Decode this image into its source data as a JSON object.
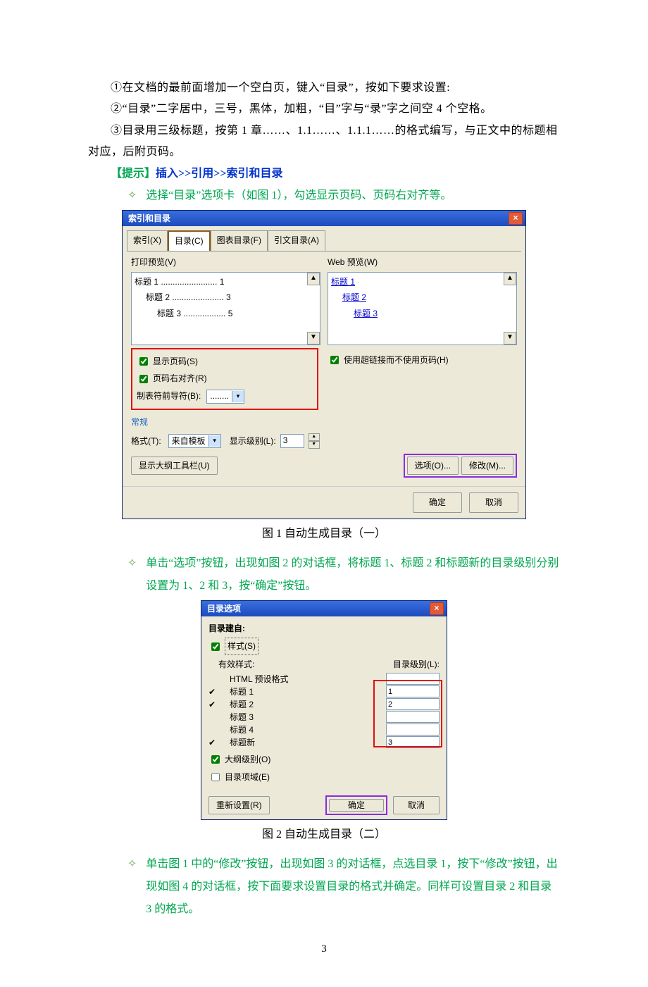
{
  "paragraphs": {
    "p1": "①在文档的最前面增加一个空白页，键入“目录”，按如下要求设置:",
    "p2": "②“目录”二字居中，三号，黑体，加粗，“目”字与“录”字之间空 4 个空格。",
    "p3": "③目录用三级标题，按第 1 章……、1.1……、1.1.1……的格式编写，与正文中的标题相对应，后附页码。",
    "tip_label": "【提示】",
    "tip_path": "插入>>引用>>索引和目录",
    "b1": "选择“目录”选项卡（如图 1），勾选显示页码、页码右对齐等。",
    "b2": "单击“选项”按钮，出现如图 2 的对话框，将标题 1、标题 2 和标题新的目录级别分别设置为 1、2 和 3，按“确定”按钮。",
    "b3": "单击图 1 中的“修改”按钮，出现如图 3 的对话框，点选目录 1，按下“修改”按钮，出现如图 4 的对话框，按下面要求设置目录的格式并确定。同样可设置目录 2 和目录 3 的格式。",
    "cap1": "图 1 自动生成目录（一）",
    "cap2": "图 2 自动生成目录（二）"
  },
  "dialog1": {
    "title": "索引和目录",
    "tabs": {
      "t1": "索引(X)",
      "t2": "目录(C)",
      "t3": "图表目录(F)",
      "t4": "引文目录(A)"
    },
    "printprev_label": "打印预览(V)",
    "webprev_label": "Web 预览(W)",
    "preview": {
      "l1": "标题 1 ........................ 1",
      "l2": "    标题 2 ...................... 3",
      "l3": "        标题 3 .................. 5"
    },
    "weblinks": {
      "h1": "标题 1",
      "h2": "标题 2",
      "h3": "标题 3"
    },
    "chk_showpage": "显示页码(S)",
    "chk_rightalign": "页码右对齐(R)",
    "leader_label": "制表符前导符(B):",
    "leader_value": "........",
    "chk_hyperlink": "使用超链接而不使用页码(H)",
    "general_label": "常规",
    "format_label": "格式(T):",
    "format_value": "来自模板",
    "levels_label": "显示级别(L):",
    "levels_value": "3",
    "outline_btn": "显示大纲工具栏(U)",
    "options_btn": "选项(O)...",
    "modify_btn": "修改(M)...",
    "ok": "确定",
    "cancel": "取消"
  },
  "dialog2": {
    "title": "目录选项",
    "build_from": "目录建自:",
    "chk_style": "样式(S)",
    "valid_styles": "有效样式:",
    "levels_col": "目录级别(L):",
    "rows": {
      "r0": "HTML 预设格式",
      "r1": "标题 1",
      "r1v": "1",
      "r2": "标题 2",
      "r2v": "2",
      "r3": "标题 3",
      "r3v": "",
      "r4": "标题 4",
      "r4v": "",
      "r5": "标题新",
      "r5v": "3"
    },
    "chk_outline": "大纲级别(O)",
    "chk_fields": "目录项域(E)",
    "reset_btn": "重新设置(R)",
    "ok": "确定",
    "cancel": "取消"
  },
  "page_number": "3"
}
